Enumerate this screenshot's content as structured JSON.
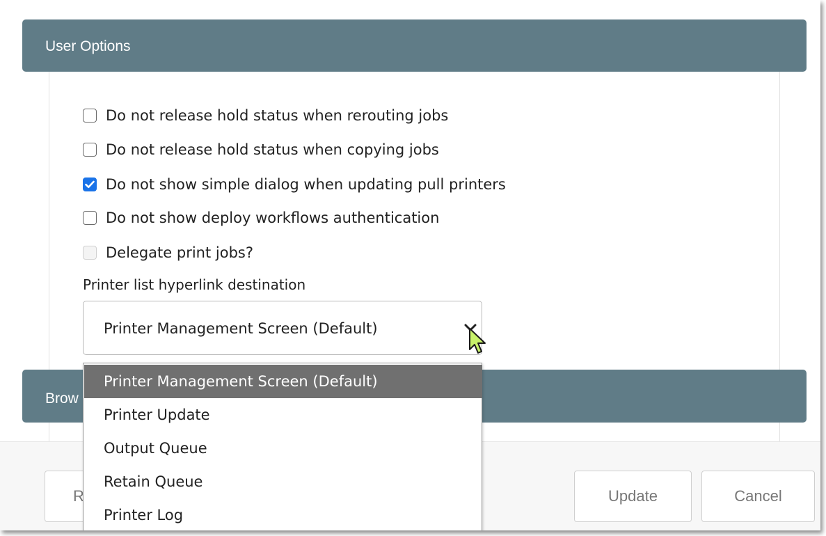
{
  "sections": {
    "user_options_title": "User Options",
    "browse_title_partial": "Brow"
  },
  "options": [
    {
      "label": "Do not release hold status when rerouting jobs",
      "checked": false,
      "disabled": false
    },
    {
      "label": "Do not release hold status when copying jobs",
      "checked": false,
      "disabled": false
    },
    {
      "label": "Do not show simple dialog when updating pull printers",
      "checked": true,
      "disabled": false
    },
    {
      "label": "Do not show deploy workflows authentication",
      "checked": false,
      "disabled": false
    },
    {
      "label": "Delegate print jobs?",
      "checked": false,
      "disabled": true
    }
  ],
  "hyperlink_destination": {
    "label": "Printer list hyperlink destination",
    "selected": "Printer Management Screen (Default)",
    "options": [
      "Printer Management Screen (Default)",
      "Printer Update",
      "Output Queue",
      "Retain Queue",
      "Printer Log"
    ]
  },
  "buttons": {
    "reset_partial": "R",
    "update": "Update",
    "cancel": "Cancel"
  },
  "colors": {
    "header_bg": "#607c87",
    "checkbox_checked": "#1a73e8",
    "dropdown_selected_bg": "#707070",
    "cursor": "#c8f26a"
  },
  "icons": {
    "select_arrow": "chevron-down-icon",
    "pointer": "mouse-cursor-icon"
  }
}
